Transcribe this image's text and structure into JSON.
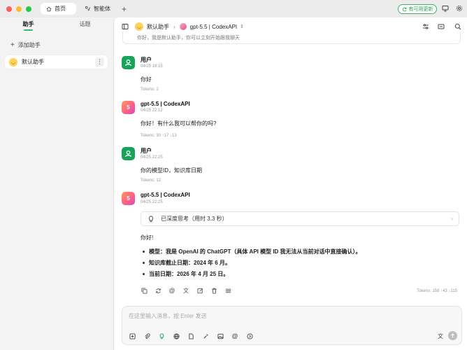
{
  "colors": {
    "accent": "#3fb46b",
    "user_avatar": "#17a35a",
    "close": "#ff5f57",
    "minimize": "#febc2e",
    "maximize": "#28c840"
  },
  "titlebar": {
    "tabs": [
      {
        "label": "首页",
        "icon": "home-icon"
      },
      {
        "label": "智能体",
        "icon": "agent-icon"
      }
    ],
    "update_label": "有可用更新"
  },
  "sidebar": {
    "tabs": [
      "助手",
      "话题"
    ],
    "add_label": "添加助手",
    "items": [
      {
        "label": "默认助手",
        "icon": "smile-emoji"
      }
    ]
  },
  "topbar": {
    "assistant": "默认助手",
    "model": "gpt-5.5 | CodexAPI"
  },
  "intro_text": "你好，我是默认助手，你可以立刻开始跟我聊天",
  "messages": [
    {
      "sender": "用户",
      "time": "04/25 19:15",
      "content": "你好",
      "tokens": "Tokens: 2"
    },
    {
      "sender": "gpt-5.5 | CodexAPI",
      "time": "04/25 22:12",
      "content": "你好！有什么我可以帮你的吗?",
      "tokens": "Tokens: 30 ↑17 ↓13"
    },
    {
      "sender": "用户",
      "time": "04/25 22:25",
      "content": "你的模型ID，知识库日期",
      "tokens": "Tokens: 12"
    },
    {
      "sender": "gpt-5.5 | CodexAPI",
      "time": "04/25 22:25",
      "thinking": "已深度思考（用时 3.3 秒）",
      "content": "你好!",
      "bullets": [
        "模型：我是 OpenAI 的 ChatGPT（具体 API 模型 ID 我无法从当前对话中直接确认）。",
        "知识库截止日期：2024 年 6 月。",
        "当前日期：2026 年 4 月 25 日。"
      ],
      "tokens": "Tokens: 158 ↑43 ↓115"
    }
  ],
  "composer": {
    "placeholder": "在这里输入消息，按 Enter 发送"
  }
}
